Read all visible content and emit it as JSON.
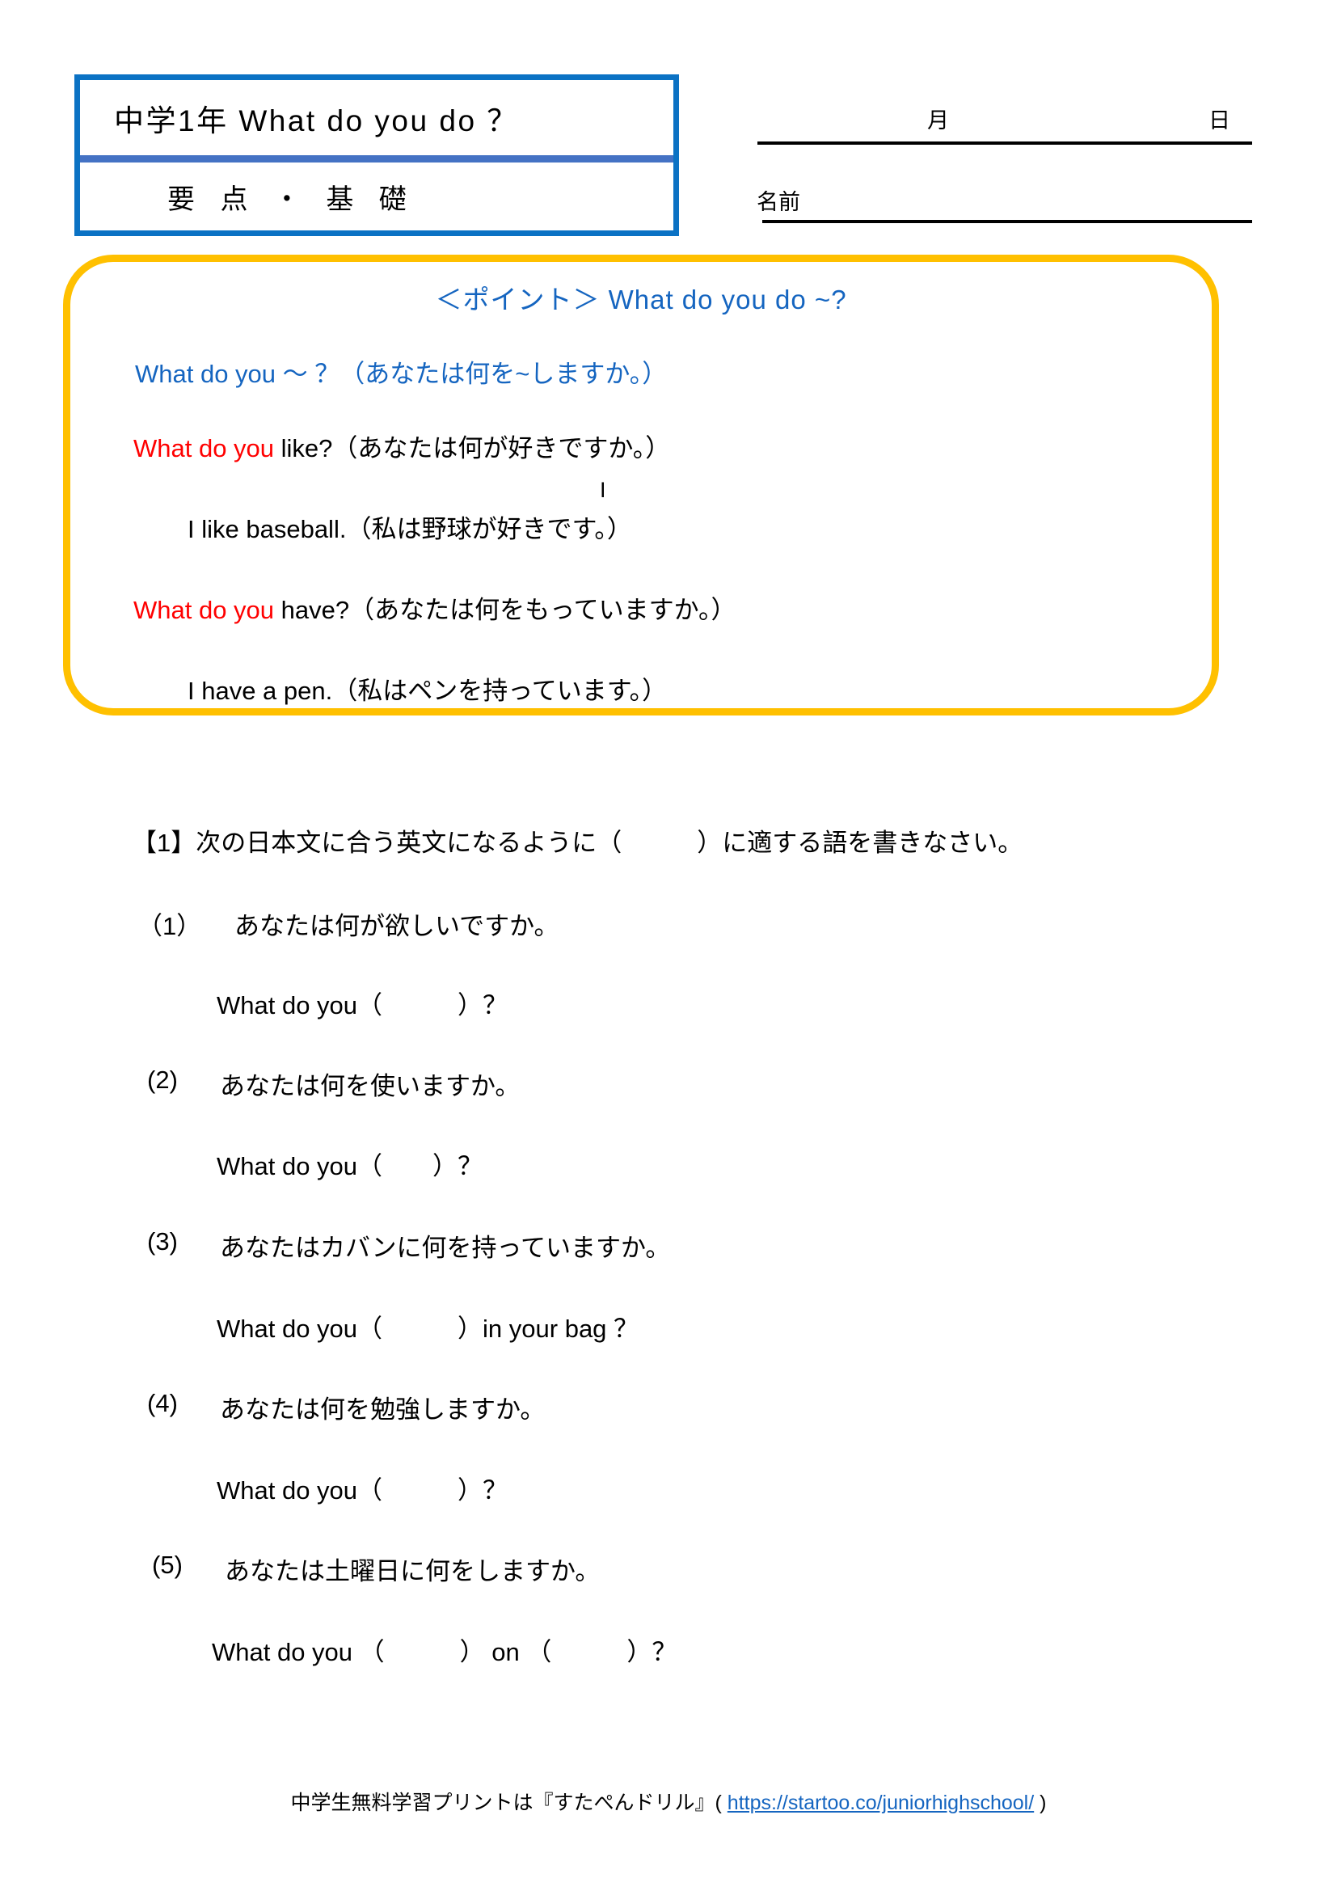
{
  "header": {
    "grade_title": "中学1年 What do you do ？",
    "section_title": "要 点 ・ 基 礎",
    "month_label": "月",
    "day_label": "日",
    "name_label": "名前",
    "box_border_color": "#0B72C4",
    "divider_color": "#4472C4"
  },
  "point_box": {
    "border_color": "#FFC000",
    "title": "＜ポイント＞ What do you do ~?",
    "accent_color": "#1565C0",
    "highlight_color": "#FF0000",
    "lines": [
      {
        "blue": "What do you ～ ？（あなたは何を~しますか。）"
      },
      {
        "red": "What do you ",
        "black": "like?（あなたは何が好きですか。）"
      },
      {
        "marker": "I"
      },
      {
        "black": "I like baseball.（私は野球が好きです。）"
      },
      {
        "red": "What do you ",
        "black": "have?（あなたは何をもっていますか。）"
      },
      {
        "black": "I have a pen.（私はペンを持っています。）"
      }
    ]
  },
  "exercise": {
    "instruction": "【1】次の日本文に合う英文になるように（　　　）に適する語を書きなさい。",
    "questions": [
      {
        "number": "（1）",
        "japanese": "あなたは何が欲しいですか。",
        "english": "What do you（　　　）？"
      },
      {
        "number": "(2)",
        "japanese": "あなたは何を使いますか。",
        "english": "What do you（　　）？"
      },
      {
        "number": "(3)",
        "japanese": "あなたはカバンに何を持っていますか。",
        "english": "What do you（　　　）in your bag ？"
      },
      {
        "number": "(4)",
        "japanese": "あなたは何を勉強しますか。",
        "english": "What do you（　　　）？"
      },
      {
        "number": "(5)",
        "japanese": "あなたは土曜日に何をしますか。",
        "english": "What do you （　　　） on （　　　）？"
      }
    ]
  },
  "footer": {
    "text_before": "中学生無料学習プリントは『すたぺんドリル』(",
    "url": "https://startoo.co/juniorhighschool/",
    "text_after": ")"
  }
}
